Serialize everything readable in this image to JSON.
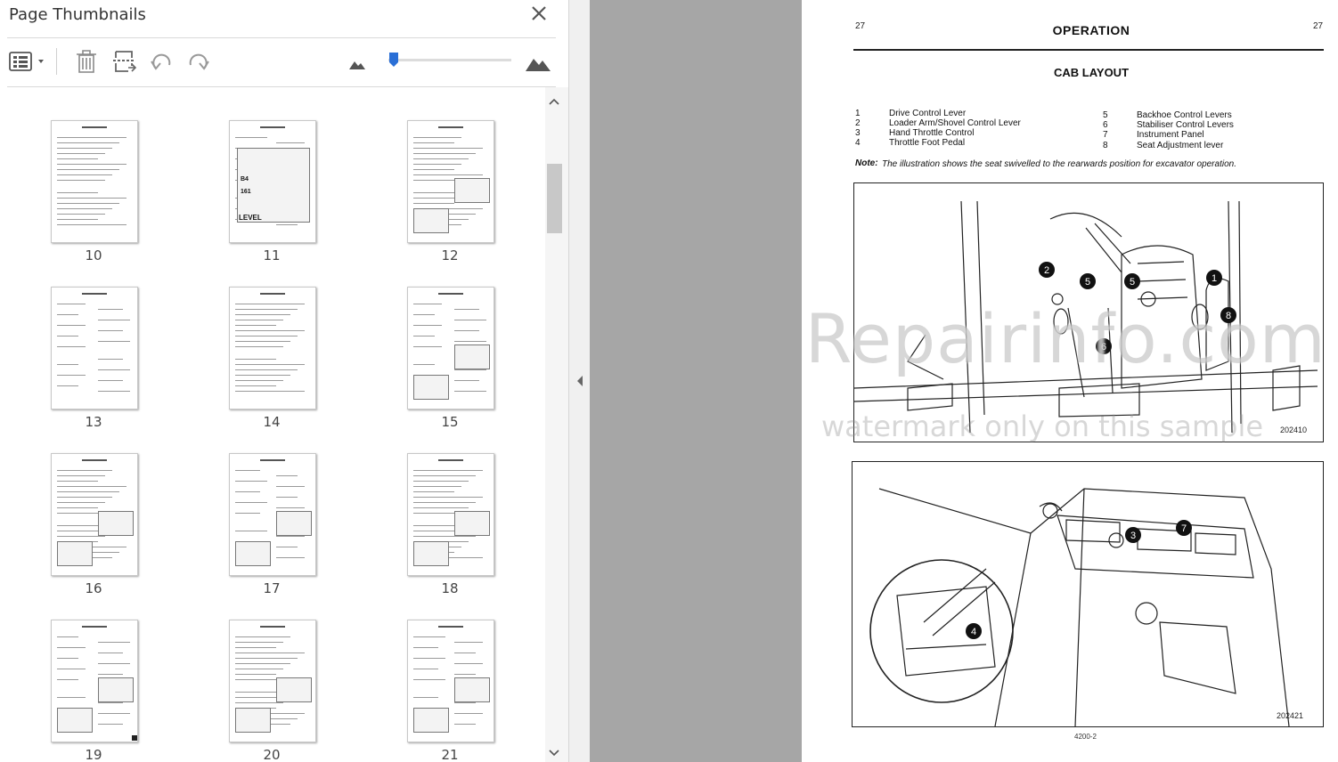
{
  "pane": {
    "title": "Page Thumbnails",
    "thumbnails": [
      {
        "page": "10"
      },
      {
        "page": "11"
      },
      {
        "page": "12"
      },
      {
        "page": "13"
      },
      {
        "page": "14"
      },
      {
        "page": "15"
      },
      {
        "page": "16"
      },
      {
        "page": "17"
      },
      {
        "page": "18"
      },
      {
        "page": "19"
      },
      {
        "page": "20"
      },
      {
        "page": "21"
      }
    ],
    "thumb11_label": "LEVEL",
    "thumb11_b4": "B4",
    "thumb11_161": "161"
  },
  "toolbar": {
    "icons": [
      "thumbnail-options-icon",
      "delete-page-icon",
      "extract-page-icon",
      "rotate-counterclockwise-icon",
      "rotate-clockwise-icon",
      "zoom-out-mountain-icon",
      "zoom-in-mountain-icon"
    ],
    "zoom_level": 0.04
  },
  "document": {
    "page_num_left": "27",
    "page_num_right": "27",
    "title": "OPERATION",
    "subtitle": "CAB LAYOUT",
    "legend": [
      {
        "num": "1",
        "text": "Drive Control Lever"
      },
      {
        "num": "2",
        "text": "Loader Arm/Shovel Control Lever"
      },
      {
        "num": "3",
        "text": "Hand Throttle Control"
      },
      {
        "num": "4",
        "text": "Throttle Foot Pedal"
      },
      {
        "num": "5",
        "text": "Backhoe Control Levers"
      },
      {
        "num": "6",
        "text": "Stabiliser Control Levers"
      },
      {
        "num": "7",
        "text": "Instrument Panel"
      },
      {
        "num": "8",
        "text": "Seat Adjustment lever"
      }
    ],
    "note_label": "Note:",
    "note_text": "The illustration shows the seat swivelled to the rearwards position for excavator operation.",
    "fig1_id": "202410",
    "fig2_id": "202421",
    "footer_code": "4200-2",
    "callouts_fig1": [
      "1",
      "2",
      "5",
      "5",
      "6",
      "8"
    ],
    "callouts_fig2": [
      "3",
      "4",
      "7"
    ],
    "watermark_main": "eRepairinfo.com",
    "watermark_sub": "watermark only on this sample"
  },
  "colors": {
    "accent": "#2a6fd6",
    "gray_gap": "#a6a6a6",
    "pane_bg": "#ffffff"
  }
}
